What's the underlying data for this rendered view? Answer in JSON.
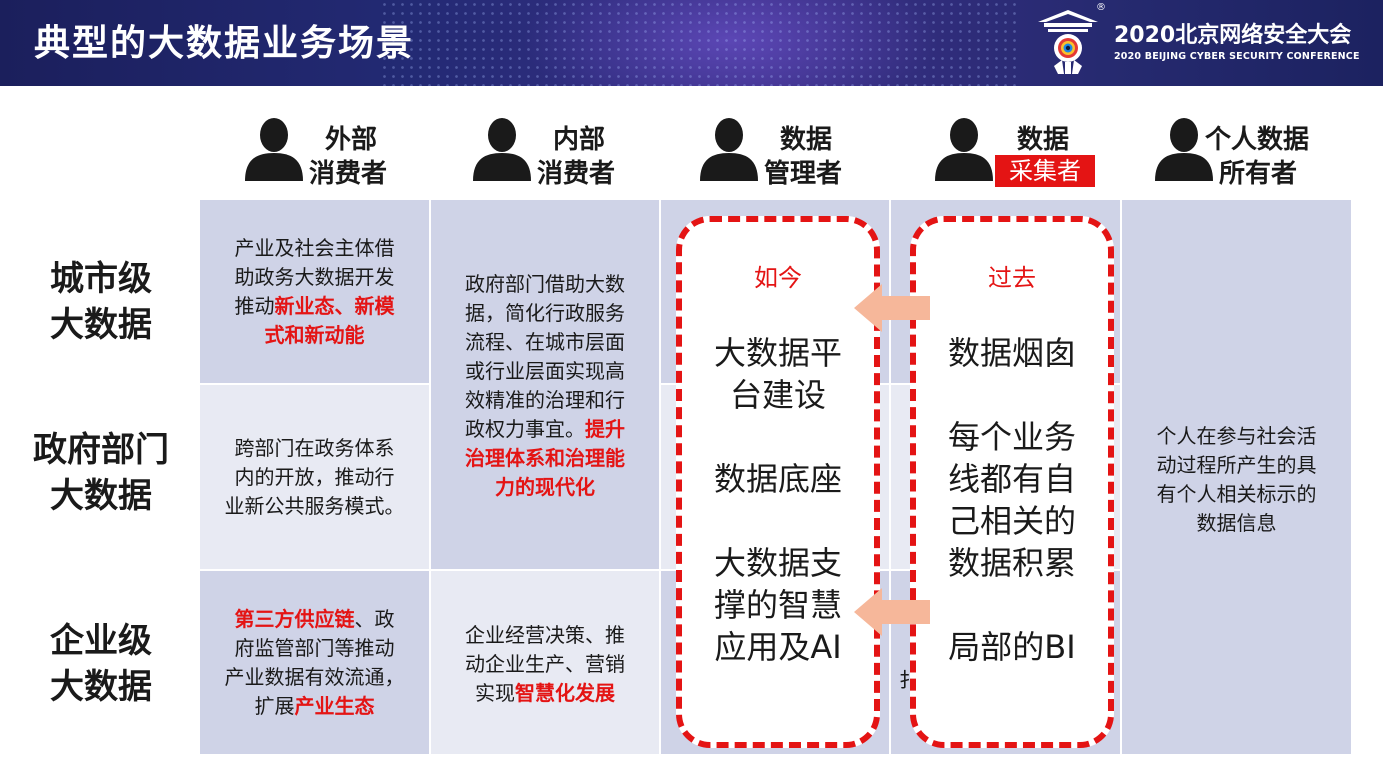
{
  "header": {
    "title": "典型的大数据业务场景",
    "conference_name": "2020北京网络安全大会",
    "conference_subtitle": "2020 BEIJING CYBER SECURITY CONFERENCE",
    "registered_mark": "®",
    "logo_icon": "conference-logo-icon",
    "background_color": "#1f2466"
  },
  "roles": [
    {
      "line1": "外部",
      "line2": "消费者",
      "icon": "person-icon"
    },
    {
      "line1": "内部",
      "line2": "消费者",
      "icon": "person-icon"
    },
    {
      "line1": "数据",
      "line2": "管理者",
      "icon": "person-icon"
    },
    {
      "line1": "数据",
      "line2": "采集者",
      "icon": "person-icon",
      "badge_color": "#e41414"
    },
    {
      "line1": "个人数据",
      "line2": "所有者",
      "icon": "person-icon"
    }
  ],
  "rows": [
    {
      "line1": "城市级",
      "line2": "大数据"
    },
    {
      "line1": "政府部门",
      "line2": "大数据"
    },
    {
      "line1": "企业级",
      "line2": "大数据"
    }
  ],
  "cells": {
    "city_external": {
      "lines": [
        "产业及社会主体借",
        "助政务大数据开发"
      ],
      "line3_prefix": "推动",
      "line3_highlight": "新业态、新模",
      "line4_highlight": "式和新动能"
    },
    "internal_top": {
      "lines": [
        "政府部门借助大数",
        "据，简化行政服务",
        "流程、在城市层面",
        "或行业层面实现高",
        "效精准的治理和行"
      ],
      "line6_prefix": "政权力事宜。",
      "line6_highlight": "提升",
      "line7_highlight": "治理体系和治理能",
      "line8_highlight": "力的现代化"
    },
    "gov_external": {
      "lines": [
        "跨部门在政务体系",
        "内的开放，推动行",
        "业新公共服务模式。"
      ]
    },
    "enterprise_external": {
      "line1_highlight": "第三方供应链",
      "line1_suffix": "、政",
      "lines": [
        "府监管部门等推动",
        "产业数据有效流通，"
      ],
      "line4_prefix": "扩展",
      "line4_highlight": "产业生态"
    },
    "enterprise_internal": {
      "lines": [
        "企业经营决策、推",
        "动企业生产、营销"
      ],
      "line3_prefix": "实现",
      "line3_highlight": "智慧化发展"
    },
    "personal_owner": {
      "lines": [
        "个人在参与社会活",
        "动过程所产生的具",
        "有个人相关标示的",
        "数据信息"
      ]
    }
  },
  "now_box": {
    "tag": "如今",
    "items": [
      "大数据平",
      "台建设",
      "数据底座",
      "大数据支",
      "撑的智慧",
      "应用及AI"
    ]
  },
  "past_box": {
    "tag": "过去",
    "items": [
      "数据烟囱",
      "每个业务",
      "线都有自",
      "己相关的",
      "数据积累",
      "局部的BI"
    ]
  },
  "peek_char": "扌",
  "colors": {
    "accent_red": "#e41414",
    "cell_dark": "#cfd3e7",
    "cell_light": "#e8eaf3",
    "arrow_fill": "#f6b79a"
  }
}
